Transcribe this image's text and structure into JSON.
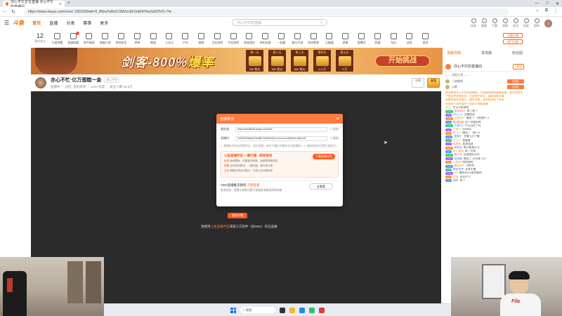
{
  "browser": {
    "tab_title": "亦心不忙正在直播 亦心不忙的直播间",
    "url": "https://www.douyu.com/xxxx/ 1263230/wlt=0_flNxuToRwCOMZzcbFUuEhFPpzGdIVfVG-74c",
    "window_controls": [
      "—",
      "□",
      "✕"
    ]
  },
  "site": {
    "logo": "斗鱼",
    "nav": [
      "首页",
      "直播",
      "分类",
      "赛事",
      "更多"
    ],
    "search_placeholder": "亦心不忙的直播",
    "header_icons": [
      "任务",
      "游戏",
      "下载",
      "消息",
      "关注",
      "历史",
      "创作"
    ]
  },
  "categories": {
    "counter": "12",
    "counter_label": "我的关注",
    "items": [
      "王者荣耀",
      "英雄联盟",
      "和平精英",
      "穿越火线",
      "绝地求生",
      "原神",
      "颜值",
      "二次元",
      "户外",
      "美食",
      "主机游戏",
      "手机游戏",
      "网游竞技",
      "单机热游",
      "一起看",
      "娱乐天地",
      "科技教育",
      "正能量",
      "赛事",
      "直播间",
      "鱼塘",
      "车队",
      "语音",
      "更多"
    ],
    "right_badges": [
      "主播开播",
      "热门分类"
    ]
  },
  "banner": {
    "title": "剑客-800%",
    "title_suffix": "爆率",
    "tiers": [
      {
        "label": "第一天",
        "amount": "200 鱼丸"
      },
      {
        "label": "第二天",
        "amount": "500 鱼丸"
      },
      {
        "label": "第三天",
        "amount": "800 鱼丸"
      },
      {
        "label": "第四天",
        "amount": "1.5 万"
      },
      {
        "label": "第五天",
        "amount": "3 万"
      }
    ],
    "cta": "开始挑战",
    "side_tabs": [
      "贡献周榜",
      "贵宾席",
      "粉丝团"
    ]
  },
  "streamer": {
    "name": "亦心不忙·亿万蛋糕一金",
    "tag": "亦心不忙",
    "sub": "直播中 ｜ 分区: 主机游戏 ｜ 1234 热度 ｜ 关注人数 26.8万",
    "buttons": [
      "分享",
      "关注"
    ]
  },
  "modal": {
    "title": "直播推流",
    "server_label": "服务器",
    "server_value": "rtmp://sendtc3a.douyu.com/live",
    "key_label": "直播码",
    "key_value": "12632304sAkoOc6Ne?wsSecret=••••••••••••••&token=web-h5",
    "copy_label": "复制",
    "note": "1. 直播码中包含直播凭证，请勿泄露；每次开播后将重新生成直播码。2. 请按照推流设置正确填写。",
    "panel_title": "斗鱼直播伴侣 一键开播 · 简单易用",
    "panel_button": "下载直播伴侣",
    "panel_lines": [
      {
        "tag": "免费",
        "text": "使用模板、设置推流参数，画面更清晰稳定"
      },
      {
        "tag": "便捷",
        "text": "支持多种素材，一键开播，操作更方便"
      },
      {
        "tag": "互动",
        "text": "弹幕礼物实时展示，与观众互动更轻松"
      }
    ],
    "footer_title": "OBS直播推流教程",
    "footer_tag": "点我查看",
    "footer_sub": "推流失败、直播卡顿等问题可查看推流教程帮助排查",
    "footer_button": "去看看"
  },
  "player": {
    "restart_button": "重新开播",
    "hint_prefix": "请使用",
    "hint_link": "斗鱼直播伴侣",
    "hint_suffix": "或第三方软件（如OBS）开启直播"
  },
  "sidebar": {
    "title": "亦心不忙的直播间",
    "follow": "+关注",
    "section": "—— 高能礼物 ——",
    "gifts": [
      {
        "name": "一枝独秀",
        "button": "去送礼"
      },
      {
        "name": "火箭",
        "button": "去送礼"
      }
    ],
    "chat": [
      {
        "badge": "",
        "user": "",
        "text": "欢迎来到亦心不忙的直播间，斗鱼倡导绿色健康直播，请文明发言"
      },
      {
        "badge": "",
        "user": "",
        "text": "严禁宣传违规信息，注意财产安全，谨防网络诈骗"
      },
      {
        "badge": "",
        "user": "",
        "text": "直播内容仅供娱乐，理性消费，请勿轻信私下交易"
      },
      {
        "badge": "",
        "user": "",
        "text": "未成年人请在监护人陪同下观看直播"
      },
      {
        "badge": "",
        "user": "亦心:",
        "text": "今天开新游戏"
      },
      {
        "badge": "Lv12",
        "user": "鱼友8823",
        "text": "来了来了"
      },
      {
        "badge": "Lv8",
        "user": "Wiz_Lol",
        "text": "主播加油"
      },
      {
        "badge": "Lv15",
        "user": "斗鱼用户",
        "text": "赠送了 一枝独秀 ×1"
      },
      {
        "badge": "Lv6",
        "user": "路过的猫",
        "text": "这个剑客好帅"
      },
      {
        "badge": "Lv20",
        "user": "大神Tnt",
        "text": "今天出货了吗"
      },
      {
        "badge": "Lv4",
        "user": "小鱼干",
        "text": "666666"
      },
      {
        "badge": "Lv9",
        "user": "阿飞飞",
        "text": "赠送了 飞机 ×1"
      },
      {
        "badge": "Lv11",
        "user": "夜猫子",
        "text": "主播几点下播"
      },
      {
        "badge": "Lv3",
        "user": "打工人",
        "text": "来看看"
      },
      {
        "badge": "Lv7",
        "user": "无名氏",
        "text": "加油加油"
      },
      {
        "badge": "Lv18",
        "user": "老粉丝",
        "text": "每天都来打卡"
      },
      {
        "badge": "Lv5",
        "user": "新人报道",
        "text": "第一次来"
      },
      {
        "badge": "Lv13",
        "user": "路人甲",
        "text": "这游戏好玩吗"
      },
      {
        "badge": "Lv10",
        "user": "甜甜圈",
        "text": "赠送了 荧光棒 ×10"
      },
      {
        "badge": "Lv2",
        "user": "小透明",
        "text": "哈哈哈哈"
      },
      {
        "badge": "Lv16",
        "user": "鱼丸大户",
        "text": "冲冲冲"
      },
      {
        "badge": "Lv8",
        "user": "晚安世界",
        "text": "支持主播"
      },
      {
        "badge": "Lv12",
        "user": "KK",
        "text": "爆率800%真的假的"
      },
      {
        "badge": "Lv6",
        "user": "大白",
        "text": "试试手气"
      },
      {
        "badge": "Lv9",
        "user": "糯米",
        "text": "来了"
      }
    ]
  },
  "taskbar": {
    "search": "搜索"
  }
}
